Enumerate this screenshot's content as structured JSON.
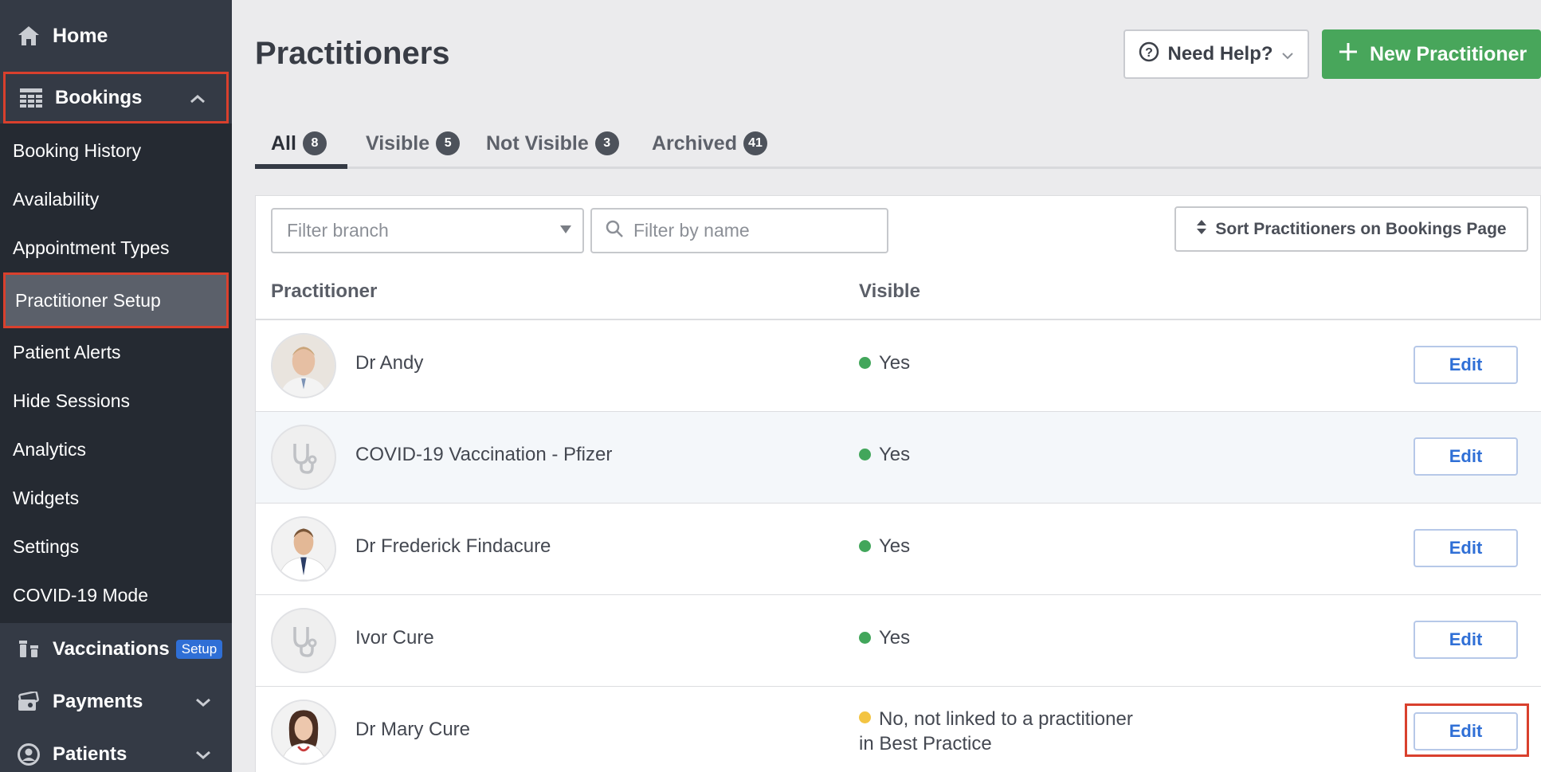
{
  "sidebar": {
    "home": "Home",
    "bookings": "Bookings",
    "sub_items": [
      "Booking History",
      "Availability",
      "Appointment Types",
      "Practitioner Setup",
      "Patient Alerts",
      "Hide Sessions",
      "Analytics",
      "Widgets",
      "Settings",
      "COVID-19 Mode"
    ],
    "vaccinations": "Vaccinations",
    "vaccinations_badge": "Setup",
    "payments": "Payments",
    "patients": "Patients"
  },
  "header": {
    "title": "Practitioners",
    "help_label": "Need Help?",
    "new_label": "New Practitioner"
  },
  "tabs": [
    {
      "label": "All",
      "count": "8"
    },
    {
      "label": "Visible",
      "count": "5"
    },
    {
      "label": "Not Visible",
      "count": "3"
    },
    {
      "label": "Archived",
      "count": "41"
    }
  ],
  "filters": {
    "branch_placeholder": "Filter branch",
    "name_placeholder": "Filter by name",
    "sort_label": "Sort Practitioners on Bookings Page"
  },
  "table": {
    "columns": [
      "Practitioner",
      "Visible"
    ],
    "edit_label": "Edit",
    "rows": [
      {
        "name": "Dr Andy",
        "visible": "Yes",
        "status": "green"
      },
      {
        "name": "COVID-19 Vaccination - Pfizer",
        "visible": "Yes",
        "status": "green"
      },
      {
        "name": "Dr Frederick Findacure",
        "visible": "Yes",
        "status": "green"
      },
      {
        "name": "Ivor Cure",
        "visible": "Yes",
        "status": "green"
      },
      {
        "name": "Dr Mary Cure",
        "visible": "No, not linked to a practitioner",
        "visible_line2": "in Best Practice",
        "status": "yellow"
      }
    ]
  },
  "colors": {
    "sidebar": "#343a45",
    "accent_green": "#48a65b",
    "link_blue": "#2f6fd6",
    "highlight_red": "#d9402d"
  }
}
